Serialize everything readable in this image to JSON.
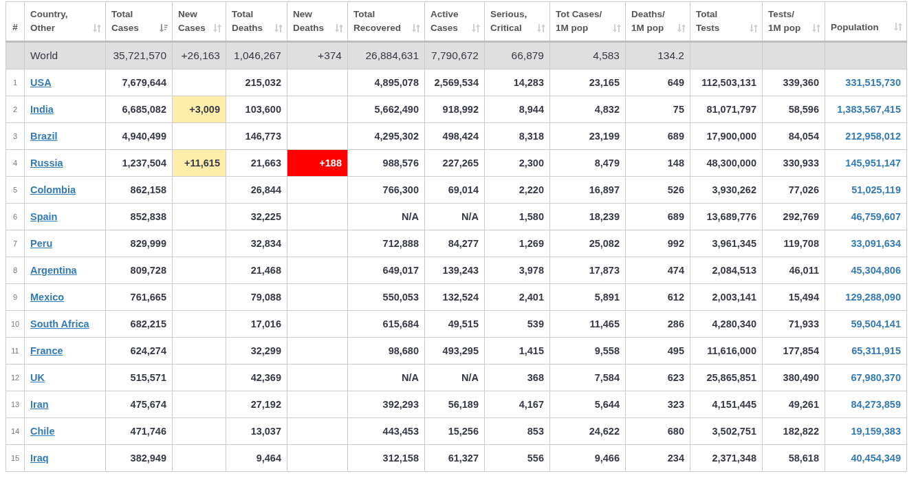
{
  "table": {
    "columns": [
      {
        "label": "#",
        "sortable": false
      },
      {
        "label": "Country,\nOther",
        "sortable": true,
        "sorted": false
      },
      {
        "label": "Total\nCases",
        "sortable": true,
        "sorted": true
      },
      {
        "label": "New\nCases",
        "sortable": true,
        "sorted": false
      },
      {
        "label": "Total\nDeaths",
        "sortable": true,
        "sorted": false
      },
      {
        "label": "New\nDeaths",
        "sortable": true,
        "sorted": false
      },
      {
        "label": "Total\nRecovered",
        "sortable": true,
        "sorted": false
      },
      {
        "label": "Active\nCases",
        "sortable": true,
        "sorted": false
      },
      {
        "label": "Serious,\nCritical",
        "sortable": true,
        "sorted": false
      },
      {
        "label": "Tot Cases/\n1M pop",
        "sortable": true,
        "sorted": false
      },
      {
        "label": "Deaths/\n1M pop",
        "sortable": true,
        "sorted": false
      },
      {
        "label": "Total\nTests",
        "sortable": true,
        "sorted": false
      },
      {
        "label": "Tests/\n1M pop",
        "sortable": true,
        "sorted": false
      },
      {
        "label": "Population",
        "sortable": true,
        "sorted": false
      }
    ],
    "world": {
      "country": "World",
      "total_cases": "35,721,570",
      "new_cases": "+26,163",
      "total_deaths": "1,046,267",
      "new_deaths": "+374",
      "total_recovered": "26,884,631",
      "active_cases": "7,790,672",
      "serious_critical": "66,879",
      "tot_cases_per_1m_pop": "4,583",
      "deaths_per_1m_pop": "134.2"
    },
    "rows": [
      {
        "rank": "1",
        "country": "USA",
        "total_cases": "7,679,644",
        "total_deaths": "215,032",
        "total_recovered": "4,895,078",
        "active_cases": "2,569,534",
        "serious_critical": "14,283",
        "tot_cases_per_1m_pop": "23,165",
        "deaths_per_1m_pop": "649",
        "total_tests": "112,503,131",
        "tests_per_1m_pop": "339,360",
        "population": "331,515,730"
      },
      {
        "rank": "2",
        "country": "India",
        "total_cases": "6,685,082",
        "new_cases": "+3,009",
        "total_deaths": "103,600",
        "total_recovered": "5,662,490",
        "active_cases": "918,992",
        "serious_critical": "8,944",
        "tot_cases_per_1m_pop": "4,832",
        "deaths_per_1m_pop": "75",
        "total_tests": "81,071,797",
        "tests_per_1m_pop": "58,596",
        "population": "1,383,567,415"
      },
      {
        "rank": "3",
        "country": "Brazil",
        "total_cases": "4,940,499",
        "total_deaths": "146,773",
        "total_recovered": "4,295,302",
        "active_cases": "498,424",
        "serious_critical": "8,318",
        "tot_cases_per_1m_pop": "23,199",
        "deaths_per_1m_pop": "689",
        "total_tests": "17,900,000",
        "tests_per_1m_pop": "84,054",
        "population": "212,958,012"
      },
      {
        "rank": "4",
        "country": "Russia",
        "total_cases": "1,237,504",
        "new_cases": "+11,615",
        "total_deaths": "21,663",
        "new_deaths": "+188",
        "total_recovered": "988,576",
        "active_cases": "227,265",
        "serious_critical": "2,300",
        "tot_cases_per_1m_pop": "8,479",
        "deaths_per_1m_pop": "148",
        "total_tests": "48,300,000",
        "tests_per_1m_pop": "330,933",
        "population": "145,951,147"
      },
      {
        "rank": "5",
        "country": "Colombia",
        "total_cases": "862,158",
        "total_deaths": "26,844",
        "total_recovered": "766,300",
        "active_cases": "69,014",
        "serious_critical": "2,220",
        "tot_cases_per_1m_pop": "16,897",
        "deaths_per_1m_pop": "526",
        "total_tests": "3,930,262",
        "tests_per_1m_pop": "77,026",
        "population": "51,025,119"
      },
      {
        "rank": "6",
        "country": "Spain",
        "total_cases": "852,838",
        "total_deaths": "32,225",
        "total_recovered": "N/A",
        "active_cases": "N/A",
        "serious_critical": "1,580",
        "tot_cases_per_1m_pop": "18,239",
        "deaths_per_1m_pop": "689",
        "total_tests": "13,689,776",
        "tests_per_1m_pop": "292,769",
        "population": "46,759,607"
      },
      {
        "rank": "7",
        "country": "Peru",
        "total_cases": "829,999",
        "total_deaths": "32,834",
        "total_recovered": "712,888",
        "active_cases": "84,277",
        "serious_critical": "1,269",
        "tot_cases_per_1m_pop": "25,082",
        "deaths_per_1m_pop": "992",
        "total_tests": "3,961,345",
        "tests_per_1m_pop": "119,708",
        "population": "33,091,634"
      },
      {
        "rank": "8",
        "country": "Argentina",
        "total_cases": "809,728",
        "total_deaths": "21,468",
        "total_recovered": "649,017",
        "active_cases": "139,243",
        "serious_critical": "3,978",
        "tot_cases_per_1m_pop": "17,873",
        "deaths_per_1m_pop": "474",
        "total_tests": "2,084,513",
        "tests_per_1m_pop": "46,011",
        "population": "45,304,806"
      },
      {
        "rank": "9",
        "country": "Mexico",
        "total_cases": "761,665",
        "total_deaths": "79,088",
        "total_recovered": "550,053",
        "active_cases": "132,524",
        "serious_critical": "2,401",
        "tot_cases_per_1m_pop": "5,891",
        "deaths_per_1m_pop": "612",
        "total_tests": "2,003,141",
        "tests_per_1m_pop": "15,494",
        "population": "129,288,090"
      },
      {
        "rank": "10",
        "country": "South Africa",
        "total_cases": "682,215",
        "total_deaths": "17,016",
        "total_recovered": "615,684",
        "active_cases": "49,515",
        "serious_critical": "539",
        "tot_cases_per_1m_pop": "11,465",
        "deaths_per_1m_pop": "286",
        "total_tests": "4,280,340",
        "tests_per_1m_pop": "71,933",
        "population": "59,504,141"
      },
      {
        "rank": "11",
        "country": "France",
        "total_cases": "624,274",
        "total_deaths": "32,299",
        "total_recovered": "98,680",
        "active_cases": "493,295",
        "serious_critical": "1,415",
        "tot_cases_per_1m_pop": "9,558",
        "deaths_per_1m_pop": "495",
        "total_tests": "11,616,000",
        "tests_per_1m_pop": "177,854",
        "population": "65,311,915"
      },
      {
        "rank": "12",
        "country": "UK",
        "total_cases": "515,571",
        "total_deaths": "42,369",
        "total_recovered": "N/A",
        "active_cases": "N/A",
        "serious_critical": "368",
        "tot_cases_per_1m_pop": "7,584",
        "deaths_per_1m_pop": "623",
        "total_tests": "25,865,851",
        "tests_per_1m_pop": "380,490",
        "population": "67,980,370"
      },
      {
        "rank": "13",
        "country": "Iran",
        "total_cases": "475,674",
        "total_deaths": "27,192",
        "total_recovered": "392,293",
        "active_cases": "56,189",
        "serious_critical": "4,167",
        "tot_cases_per_1m_pop": "5,644",
        "deaths_per_1m_pop": "323",
        "total_tests": "4,151,445",
        "tests_per_1m_pop": "49,261",
        "population": "84,273,859"
      },
      {
        "rank": "14",
        "country": "Chile",
        "total_cases": "471,746",
        "total_deaths": "13,037",
        "total_recovered": "443,453",
        "active_cases": "15,256",
        "serious_critical": "853",
        "tot_cases_per_1m_pop": "24,622",
        "deaths_per_1m_pop": "680",
        "total_tests": "3,502,751",
        "tests_per_1m_pop": "182,822",
        "population": "19,159,383"
      },
      {
        "rank": "15",
        "country": "Iraq",
        "total_cases": "382,949",
        "total_deaths": "9,464",
        "total_recovered": "312,158",
        "active_cases": "61,327",
        "serious_critical": "556",
        "tot_cases_per_1m_pop": "9,466",
        "deaths_per_1m_pop": "234",
        "total_tests": "2,371,348",
        "tests_per_1m_pop": "58,618",
        "population": "40,454,349"
      }
    ]
  }
}
